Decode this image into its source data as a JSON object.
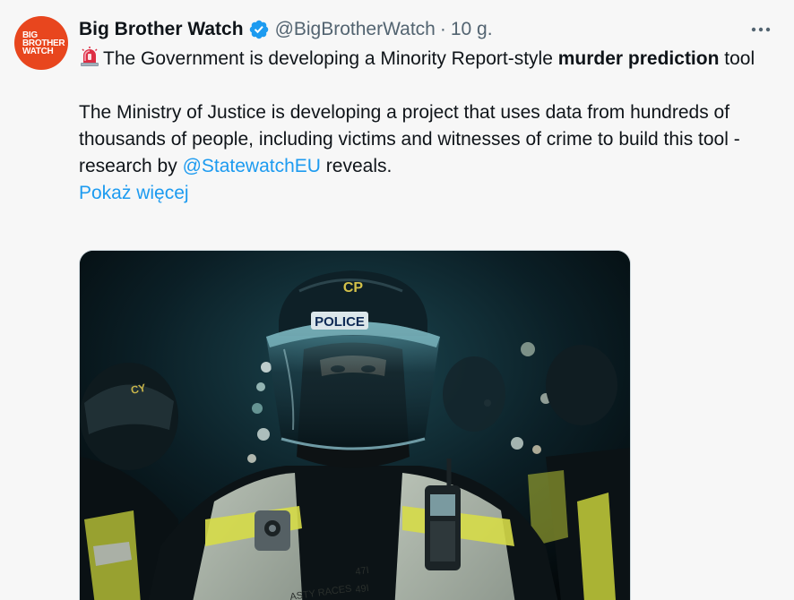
{
  "account": {
    "avatar_lines": [
      "BIG",
      "BROTHER",
      "WATCH"
    ],
    "display_name": "Big Brother Watch",
    "handle": "@BigBrotherWatch",
    "separator": "·",
    "time": "10 g.",
    "verified": true
  },
  "tweet": {
    "emoji_icon": "rotating-light-icon",
    "line1_a": "The Government is developing a Minority Report-style ",
    "line1_b": "murder prediction",
    "line1_c": " tool",
    "para2_a": "The Ministry of Justice is developing a project that uses data from hundreds of thousands of people, including victims and witnesses of crime to build this tool - research by ",
    "para2_mention": "@StatewatchEU",
    "para2_b": " reveals.",
    "show_more": "Pokaż więcej"
  },
  "media": {
    "helmet_badge": "CP",
    "visor_label": "POLICE",
    "side_helmet_badge": "CY",
    "vest_text_1": "ASTY RACES",
    "vest_text_2": "47I",
    "vest_text_3": "49I"
  },
  "colors": {
    "accent": "#1d9bf0",
    "avatar_bg": "#e8461e",
    "text": "#0f1419",
    "secondary_text": "#536471"
  }
}
